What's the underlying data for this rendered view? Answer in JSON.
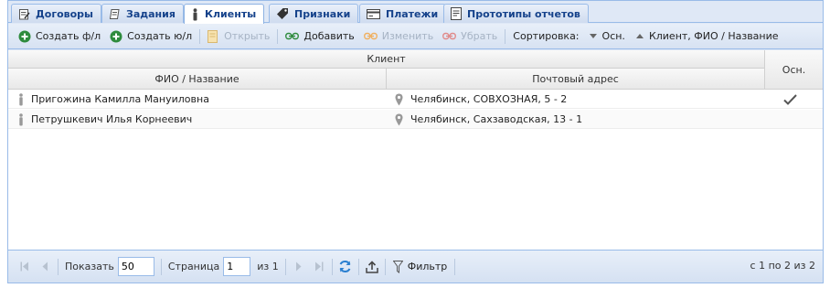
{
  "tabs": [
    {
      "label": "Договоры",
      "icon": "contract-icon"
    },
    {
      "label": "Задания",
      "icon": "task-icon"
    },
    {
      "label": "Клиенты",
      "icon": "person-icon",
      "active": true
    },
    {
      "label": "Признаки",
      "icon": "tag-icon"
    },
    {
      "label": "Платежи",
      "icon": "payment-icon"
    },
    {
      "label": "Прототипы отчетов",
      "icon": "report-icon"
    }
  ],
  "toolbar": {
    "create_individual": "Создать ф/л",
    "create_legal": "Создать ю/л",
    "open": "Открыть",
    "add": "Добавить",
    "edit": "Изменить",
    "remove": "Убрать",
    "sort_label": "Сортировка:",
    "sort_primary": "Осн.",
    "sort_secondary": "Клиент, ФИО / Название"
  },
  "grid": {
    "group_header": "Клиент",
    "columns": {
      "name": "ФИО / Название",
      "address": "Почтовый адрес",
      "main": "Осн."
    },
    "rows": [
      {
        "name": "Пригожина Камилла Мануиловна",
        "address": "Челябинск, СОВХОЗНАЯ, 5 - 2",
        "main": true
      },
      {
        "name": "Петрушкевич Илья Корнеевич",
        "address": "Челябинск, Сахзаводская, 13 - 1",
        "main": false
      }
    ]
  },
  "pager": {
    "show_label": "Показать",
    "page_size": "50",
    "page_label": "Страница",
    "page_value": "1",
    "of_pages": "из 1",
    "filter_label": "Фильтр",
    "status": "с 1 по 2 из 2"
  },
  "colors": {
    "border": "#99bbe8",
    "tab_text": "#15428b",
    "accent_green": "#2e8b3d"
  }
}
